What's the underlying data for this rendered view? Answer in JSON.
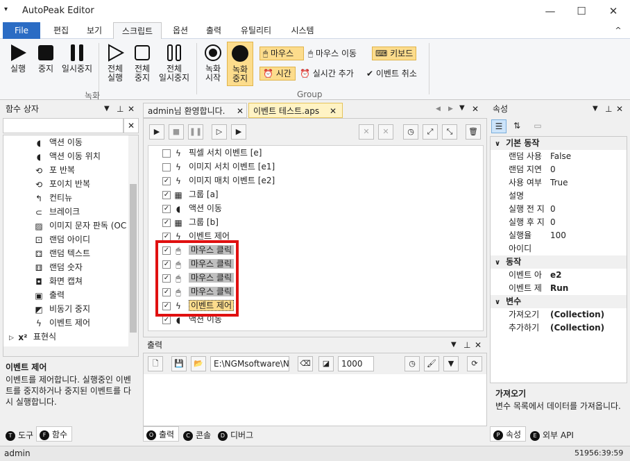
{
  "app": {
    "title": "AutoPeak Editor",
    "min": "—",
    "max": "☐",
    "close": "✕"
  },
  "menu": {
    "file": "File",
    "items": [
      "편집",
      "보기",
      "스크립트",
      "옵션",
      "출력",
      "유틸리티",
      "시스템"
    ],
    "collapse": "^"
  },
  "ribbon": {
    "run": "실행",
    "stop": "중지",
    "pause": "일시중지",
    "run_all": "전체\n실행",
    "stop_all": "전체\n중지",
    "pause_all": "전체\n일시중지",
    "rec_start": "녹화\n시작",
    "rec_stop": "녹화\n중지",
    "group_rec": "녹화",
    "mouse": "마우스",
    "mouse_move": "마우스 이동",
    "keyboard": "키보드",
    "time": "시간",
    "realtime_add": "실시간 추가",
    "event_cancel": "이벤트 취소",
    "group_label": "Group"
  },
  "left": {
    "title": "함수 상자",
    "items": [
      "액션 이동",
      "액션 이동 위치",
      "포 반복",
      "포이치 반복",
      "컨티뉴",
      "브레이크",
      "이미지 문자 판독 (OC",
      "랜덤 아이디",
      "랜덤 텍스트",
      "랜덤 숫자",
      "화면 캡쳐",
      "출력",
      "비동기 중지",
      "이벤트 제어",
      "표현식"
    ],
    "desc_title": "이벤트 제어",
    "desc": "이벤트를 제어합니다. 실행중인 이벤트를 중지하거나 중지된 이벤트를 다시 실행합니다.",
    "tabs": [
      "도구",
      "함수"
    ]
  },
  "doc": {
    "tabs": [
      "admin님 환영합니다.",
      "이벤트 테스트.aps"
    ],
    "rows": [
      {
        "checked": false,
        "icon": "ϟ",
        "label": "픽셀 서치 이벤트 [e]"
      },
      {
        "checked": false,
        "icon": "ϟ",
        "label": "이미지 서치 이벤트 [e1]"
      },
      {
        "checked": true,
        "icon": "ϟ",
        "label": "이미지 매치 이벤트 [e2]"
      },
      {
        "checked": true,
        "icon": "▦",
        "label": "그룹 [a]"
      },
      {
        "checked": true,
        "icon": "◖",
        "label": "액션 이동"
      },
      {
        "checked": true,
        "icon": "▦",
        "label": "그룹 [b]"
      },
      {
        "checked": true,
        "icon": "ϟ",
        "label": "이벤트 제어"
      },
      {
        "checked": true,
        "icon": "🖱",
        "label": "마우스 클릭",
        "hl": true
      },
      {
        "checked": true,
        "icon": "🖱",
        "label": "마우스 클릭",
        "hl": true
      },
      {
        "checked": true,
        "icon": "🖱",
        "label": "마우스 클릭",
        "hl": true
      },
      {
        "checked": true,
        "icon": "🖱",
        "label": "마우스 클릭",
        "hl": true
      },
      {
        "checked": true,
        "icon": "ϟ",
        "label": "이벤트 제어",
        "sel": true
      },
      {
        "checked": true,
        "icon": "◖",
        "label": "액션 이동"
      }
    ]
  },
  "output": {
    "title": "출력",
    "path": "E:\\NGMsoftware\\NG",
    "num": "1000",
    "tabs": [
      "출력",
      "콘솔",
      "디버그"
    ]
  },
  "props": {
    "title": "속성",
    "cats": [
      {
        "name": "기본 동작",
        "rows": [
          [
            "랜덤 사용",
            "False"
          ],
          [
            "랜덤 지연",
            "0"
          ],
          [
            "사용 여부",
            "True"
          ],
          [
            "설명",
            ""
          ],
          [
            "실행 전 지",
            "0"
          ],
          [
            "실행 후 지",
            "0"
          ],
          [
            "실행율",
            "100"
          ],
          [
            "아이디",
            ""
          ]
        ]
      },
      {
        "name": "동작",
        "rows": [
          [
            "이벤트 아",
            "e2"
          ],
          [
            "이벤트 제",
            "Run"
          ]
        ]
      },
      {
        "name": "변수",
        "rows": [
          [
            "가져오기",
            "(Collection)"
          ],
          [
            "추가하기",
            "(Collection)"
          ]
        ]
      }
    ],
    "desc_title": "가져오기",
    "desc": "변수 목록에서 데이터를 가져옵니다.",
    "tabs": [
      "속성",
      "외부 API"
    ]
  },
  "status": {
    "user": "admin",
    "time": "51956:39:59"
  }
}
